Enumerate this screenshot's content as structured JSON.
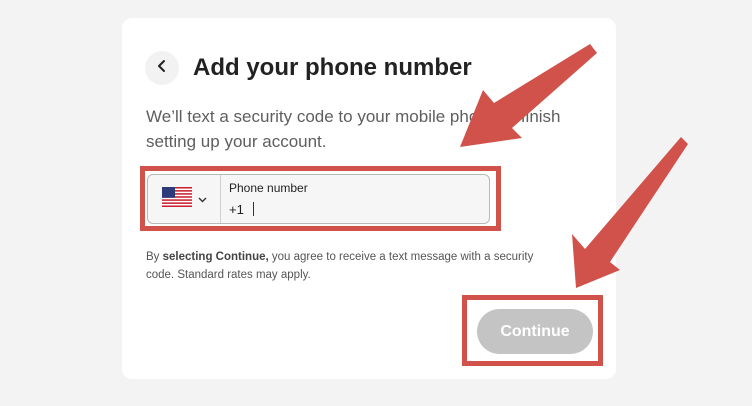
{
  "dialog": {
    "title": "Add your phone number",
    "subtitle": "We’ll text a security code to your mobile phone to finish setting up your account.",
    "back_icon": "chevron-left-icon"
  },
  "phone": {
    "country_flag": "us-flag-icon",
    "dropdown_icon": "chevron-down-icon",
    "label": "Phone number",
    "prefix": "+1",
    "value": ""
  },
  "consent": {
    "prefix": "By ",
    "bold": "selecting Continue,",
    "line1_rest": " you agree to receive a text message with a security",
    "line2": "code. Standard rates may apply."
  },
  "actions": {
    "continue_label": "Continue"
  },
  "colors": {
    "annotation": "#d1524a",
    "button_disabled": "#c4c4c4",
    "background": "#f3f3f3"
  }
}
